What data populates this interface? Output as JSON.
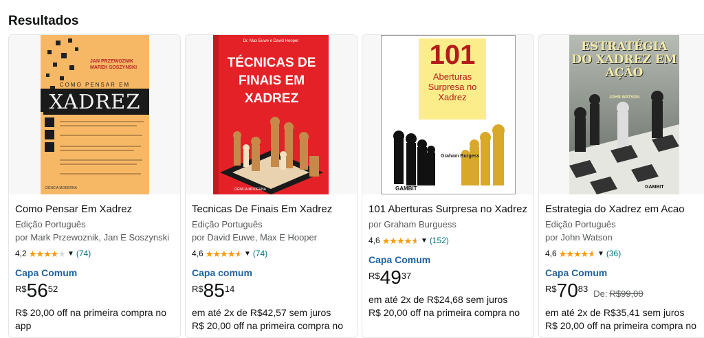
{
  "heading": "Resultados",
  "products": [
    {
      "title": "Como Pensar Em Xadrez",
      "edition": "Edição Português",
      "authors": "por Mark Przewoznik, Jan E Soszynski",
      "rating": "4,2",
      "rating_value": 4.2,
      "reviews": "(74)",
      "binding": "Capa Comum",
      "currency": "R$",
      "price_whole": "56",
      "price_fraction": "52",
      "offer": "R$ 20,00 off na primeira compra no app",
      "cover": {
        "authors": "JAN PRZEWOZNIK\nMAREK SOSZYNSKI",
        "series": "COMO PENSAR EM",
        "title": "XADREZ",
        "publisher": "CIÊNCIA MODERNA"
      }
    },
    {
      "title": "Tecnicas De Finais Em Xadrez",
      "edition": "Edição Português",
      "authors": "por David Euwe, Max E Hooper",
      "rating": "4,6",
      "rating_value": 4.6,
      "reviews": "(74)",
      "binding": "Capa comum",
      "currency": "R$",
      "price_whole": "85",
      "price_fraction": "14",
      "installments": "em até 2x de R$42,57 sem juros",
      "offer": "R$ 20,00 off na primeira compra no",
      "cover": {
        "authors": "Dr. Max Euwe e David Hooper",
        "title": "TÉCNICAS DE FINAIS EM XADREZ",
        "publisher": "CIÊNCIA MODERNA"
      }
    },
    {
      "title": "101 Aberturas Surpresa no Xadrez",
      "edition": "",
      "authors": "por Graham Burguess",
      "rating": "4,6",
      "rating_value": 4.6,
      "reviews": "(152)",
      "binding": "Capa Comum",
      "currency": "R$",
      "price_whole": "49",
      "price_fraction": "37",
      "installments": "em até 2x de R$24,68 sem juros",
      "offer": "R$ 20,00 off na primeira compra no",
      "cover": {
        "number": "101",
        "title": "Aberturas Surpresa no Xadrez",
        "author": "Graham Burgess",
        "publisher": "GAMBIT"
      }
    },
    {
      "title": "Estrategia do Xadrez em Acao",
      "edition": "Edição Português",
      "authors": "por John Watson",
      "rating": "4,6",
      "rating_value": 4.6,
      "reviews": "(36)",
      "binding": "Capa Comum",
      "currency": "R$",
      "price_whole": "70",
      "price_fraction": "83",
      "list_label": "De:",
      "list_price": "R$99,00",
      "installments": "em até 2x de R$35,41 sem juros",
      "offer": "R$ 20,00 off na primeira compra no",
      "cover": {
        "title": "ESTRATÉGIA DO XADREZ EM AÇÃO",
        "author": "JOHN WATSON",
        "publisher": "GAMBIT"
      }
    }
  ],
  "colors": {
    "link": "#007185",
    "binding": "#2162a1",
    "star": "#ff9900",
    "cover2_red": "#e52128",
    "cover1_orange": "#f7b866"
  }
}
